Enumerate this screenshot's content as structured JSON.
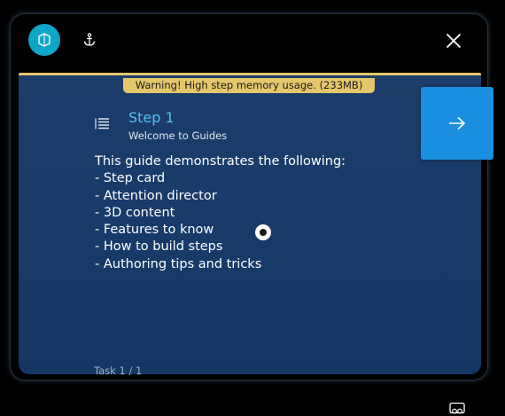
{
  "warning": {
    "text": "Warning! High step memory usage. (233MB)",
    "color": "#e4c76b"
  },
  "toolbar": {
    "pin_icon": "pin-panel-icon",
    "anchor_icon": "anchor-icon",
    "close_icon": "close-icon"
  },
  "step": {
    "title": "Step 1",
    "subtitle": "Welcome to Guides",
    "outline_icon": "outline-list-icon",
    "body": [
      "This guide demonstrates the following:",
      "- Step card",
      "- Attention director",
      "- 3D content",
      "- Features to know",
      "- How to build steps",
      "- Authoring tips and tricks"
    ]
  },
  "next_button": {
    "icon": "arrow-right-icon",
    "color": "#1a8fe0"
  },
  "footer": {
    "task_label": "Task 1 / 1",
    "media_icon": "media-icon"
  },
  "colors": {
    "accent": "#0ea5c8",
    "title": "#4fc3ef",
    "card_background": "#173a69"
  }
}
